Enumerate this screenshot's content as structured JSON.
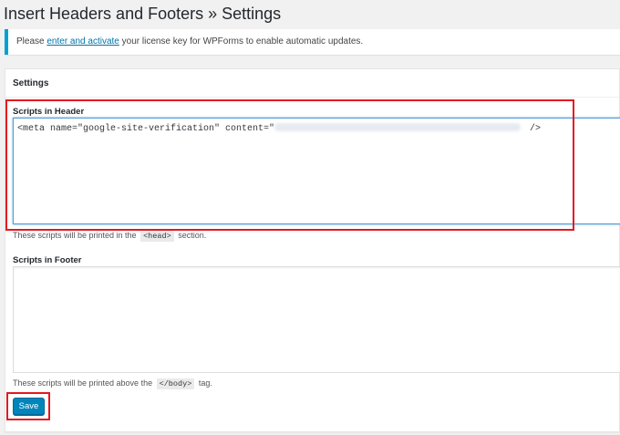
{
  "page": {
    "title": "Insert Headers and Footers » Settings"
  },
  "notice": {
    "prefix": "Please ",
    "link_text": "enter and activate",
    "suffix": " your license key for WPForms to enable automatic updates.",
    "accent_color": "#00a0d2"
  },
  "settings": {
    "box_title": "Settings",
    "header": {
      "label": "Scripts in Header",
      "value_prefix": "<meta name=\"google-site-verification\" content=\"",
      "value_suffix": " />",
      "description_prefix": "These scripts will be printed in the ",
      "description_code": "<head>",
      "description_suffix": " section."
    },
    "footer": {
      "label": "Scripts in Footer",
      "value": "",
      "description_prefix": "These scripts will be printed above the ",
      "description_code": "</body>",
      "description_suffix": " tag."
    },
    "save_label": "Save"
  },
  "colors": {
    "primary_button": "#0085ba",
    "highlight": "#e3181f",
    "link": "#0073aa"
  }
}
